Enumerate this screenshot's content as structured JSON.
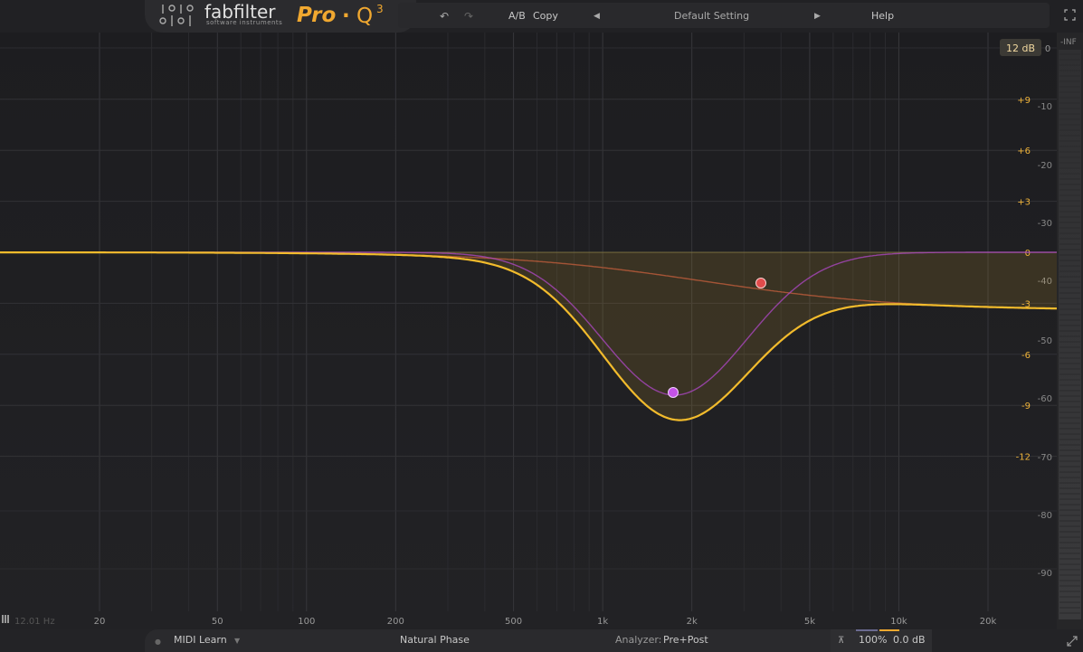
{
  "header": {
    "brand_name": "fabfilter",
    "brand_sub": "software instruments",
    "product": "Pro",
    "product_dot": "·",
    "product_q": "Q",
    "product_version": "3",
    "ab": "A/B",
    "copy": "Copy",
    "preset": "Default Setting",
    "help": "Help"
  },
  "graph": {
    "range_button": "12 dB",
    "gain_labels": [
      "+9",
      "+6",
      "+3",
      "0",
      "-3",
      "-6",
      "-9",
      "-12"
    ],
    "analyzer_labels": [
      "0",
      "-10",
      "-20",
      "-30",
      "-40",
      "-50",
      "-60",
      "-70",
      "-80",
      "-90"
    ],
    "inf_label": "-INF",
    "freq_readout": "12.01 Hz",
    "freq_labels": [
      "20",
      "50",
      "100",
      "200",
      "500",
      "1k",
      "2k",
      "5k",
      "10k",
      "20k"
    ]
  },
  "colors": {
    "output_curve": "#f2bb2c",
    "band1": "#e24b4b",
    "band2": "#c552e8",
    "accent_orange": "#f0a830"
  },
  "bottom": {
    "midi_learn": "MIDI Learn",
    "phase": "Natural Phase",
    "analyzer_label": "Analyzer:",
    "analyzer_value": "Pre+Post",
    "zoom": "100%",
    "output_gain": "0.0 dB"
  }
}
